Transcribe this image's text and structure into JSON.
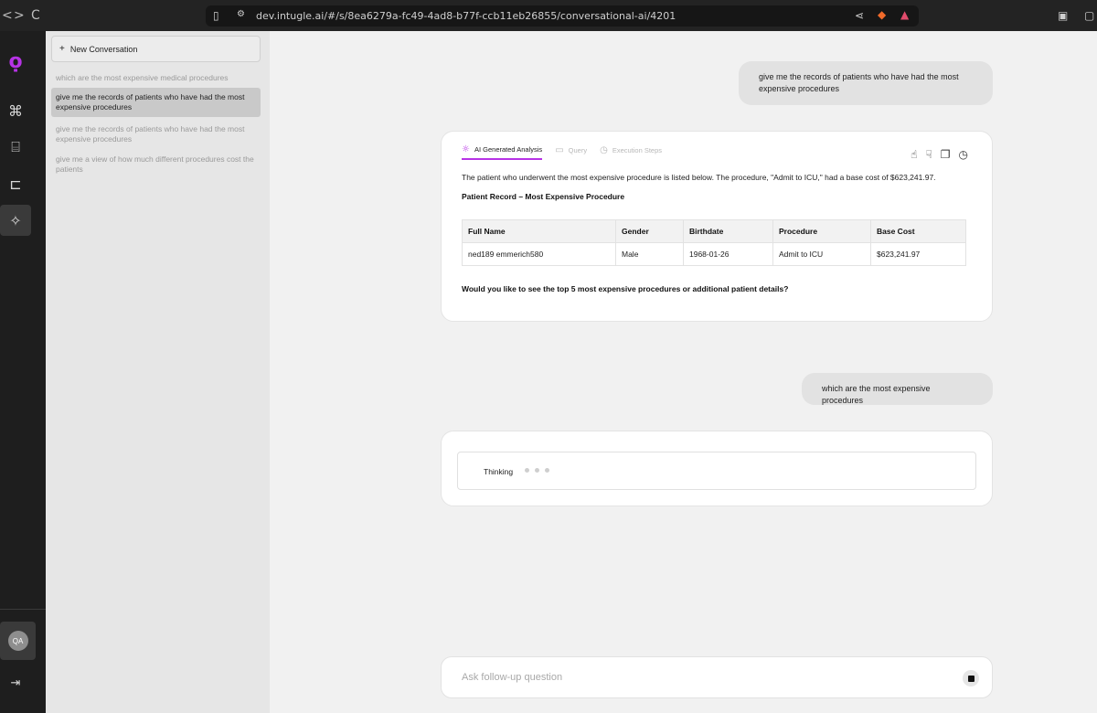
{
  "browser": {
    "back": "<",
    "forward": ">",
    "reload": "C",
    "url": "dev.intugle.ai/#/s/8ea6279a-fc49-4ad8-b77f-ccb11eb26855/conversational-ai/4201"
  },
  "rail": {
    "avatar_initials": "QA"
  },
  "history": {
    "new_conversation": "New Conversation",
    "items": [
      "which are the most expensive medical procedures",
      "give me the records of patients who have had the most expensive procedures",
      "give me the records of patients who have had the most expensive procedures",
      "give me a view of how much different procedures cost the patients"
    ]
  },
  "chat": {
    "user_message_1": "give me the records of patients who have had the most expensive procedures",
    "tabs": [
      "AI Generated Analysis",
      "Query",
      "Execution Steps"
    ],
    "summary": "The patient who underwent the most expensive procedure is listed below. The procedure, \"Admit to ICU,\" had a base cost of $623,241.97.",
    "record_title": "Patient Record – Most Expensive Procedure",
    "table": {
      "headers": [
        "Full Name",
        "Gender",
        "Birthdate",
        "Procedure",
        "Base Cost"
      ],
      "rows": [
        [
          "ned189 emmerich580",
          "Male",
          "1968-01-26",
          "Admit to ICU",
          "$623,241.97"
        ]
      ]
    },
    "question": "Would you like to see the top 5 most expensive procedures or additional patient details?",
    "user_message_2": "which are the most expensive procedures",
    "thinking": "Thinking"
  },
  "input": {
    "placeholder": "Ask follow-up question"
  },
  "colors": {
    "accent": "#b733e6",
    "rail_bg": "#1e1e1e",
    "sidebar_bg": "#e6e6e6"
  }
}
